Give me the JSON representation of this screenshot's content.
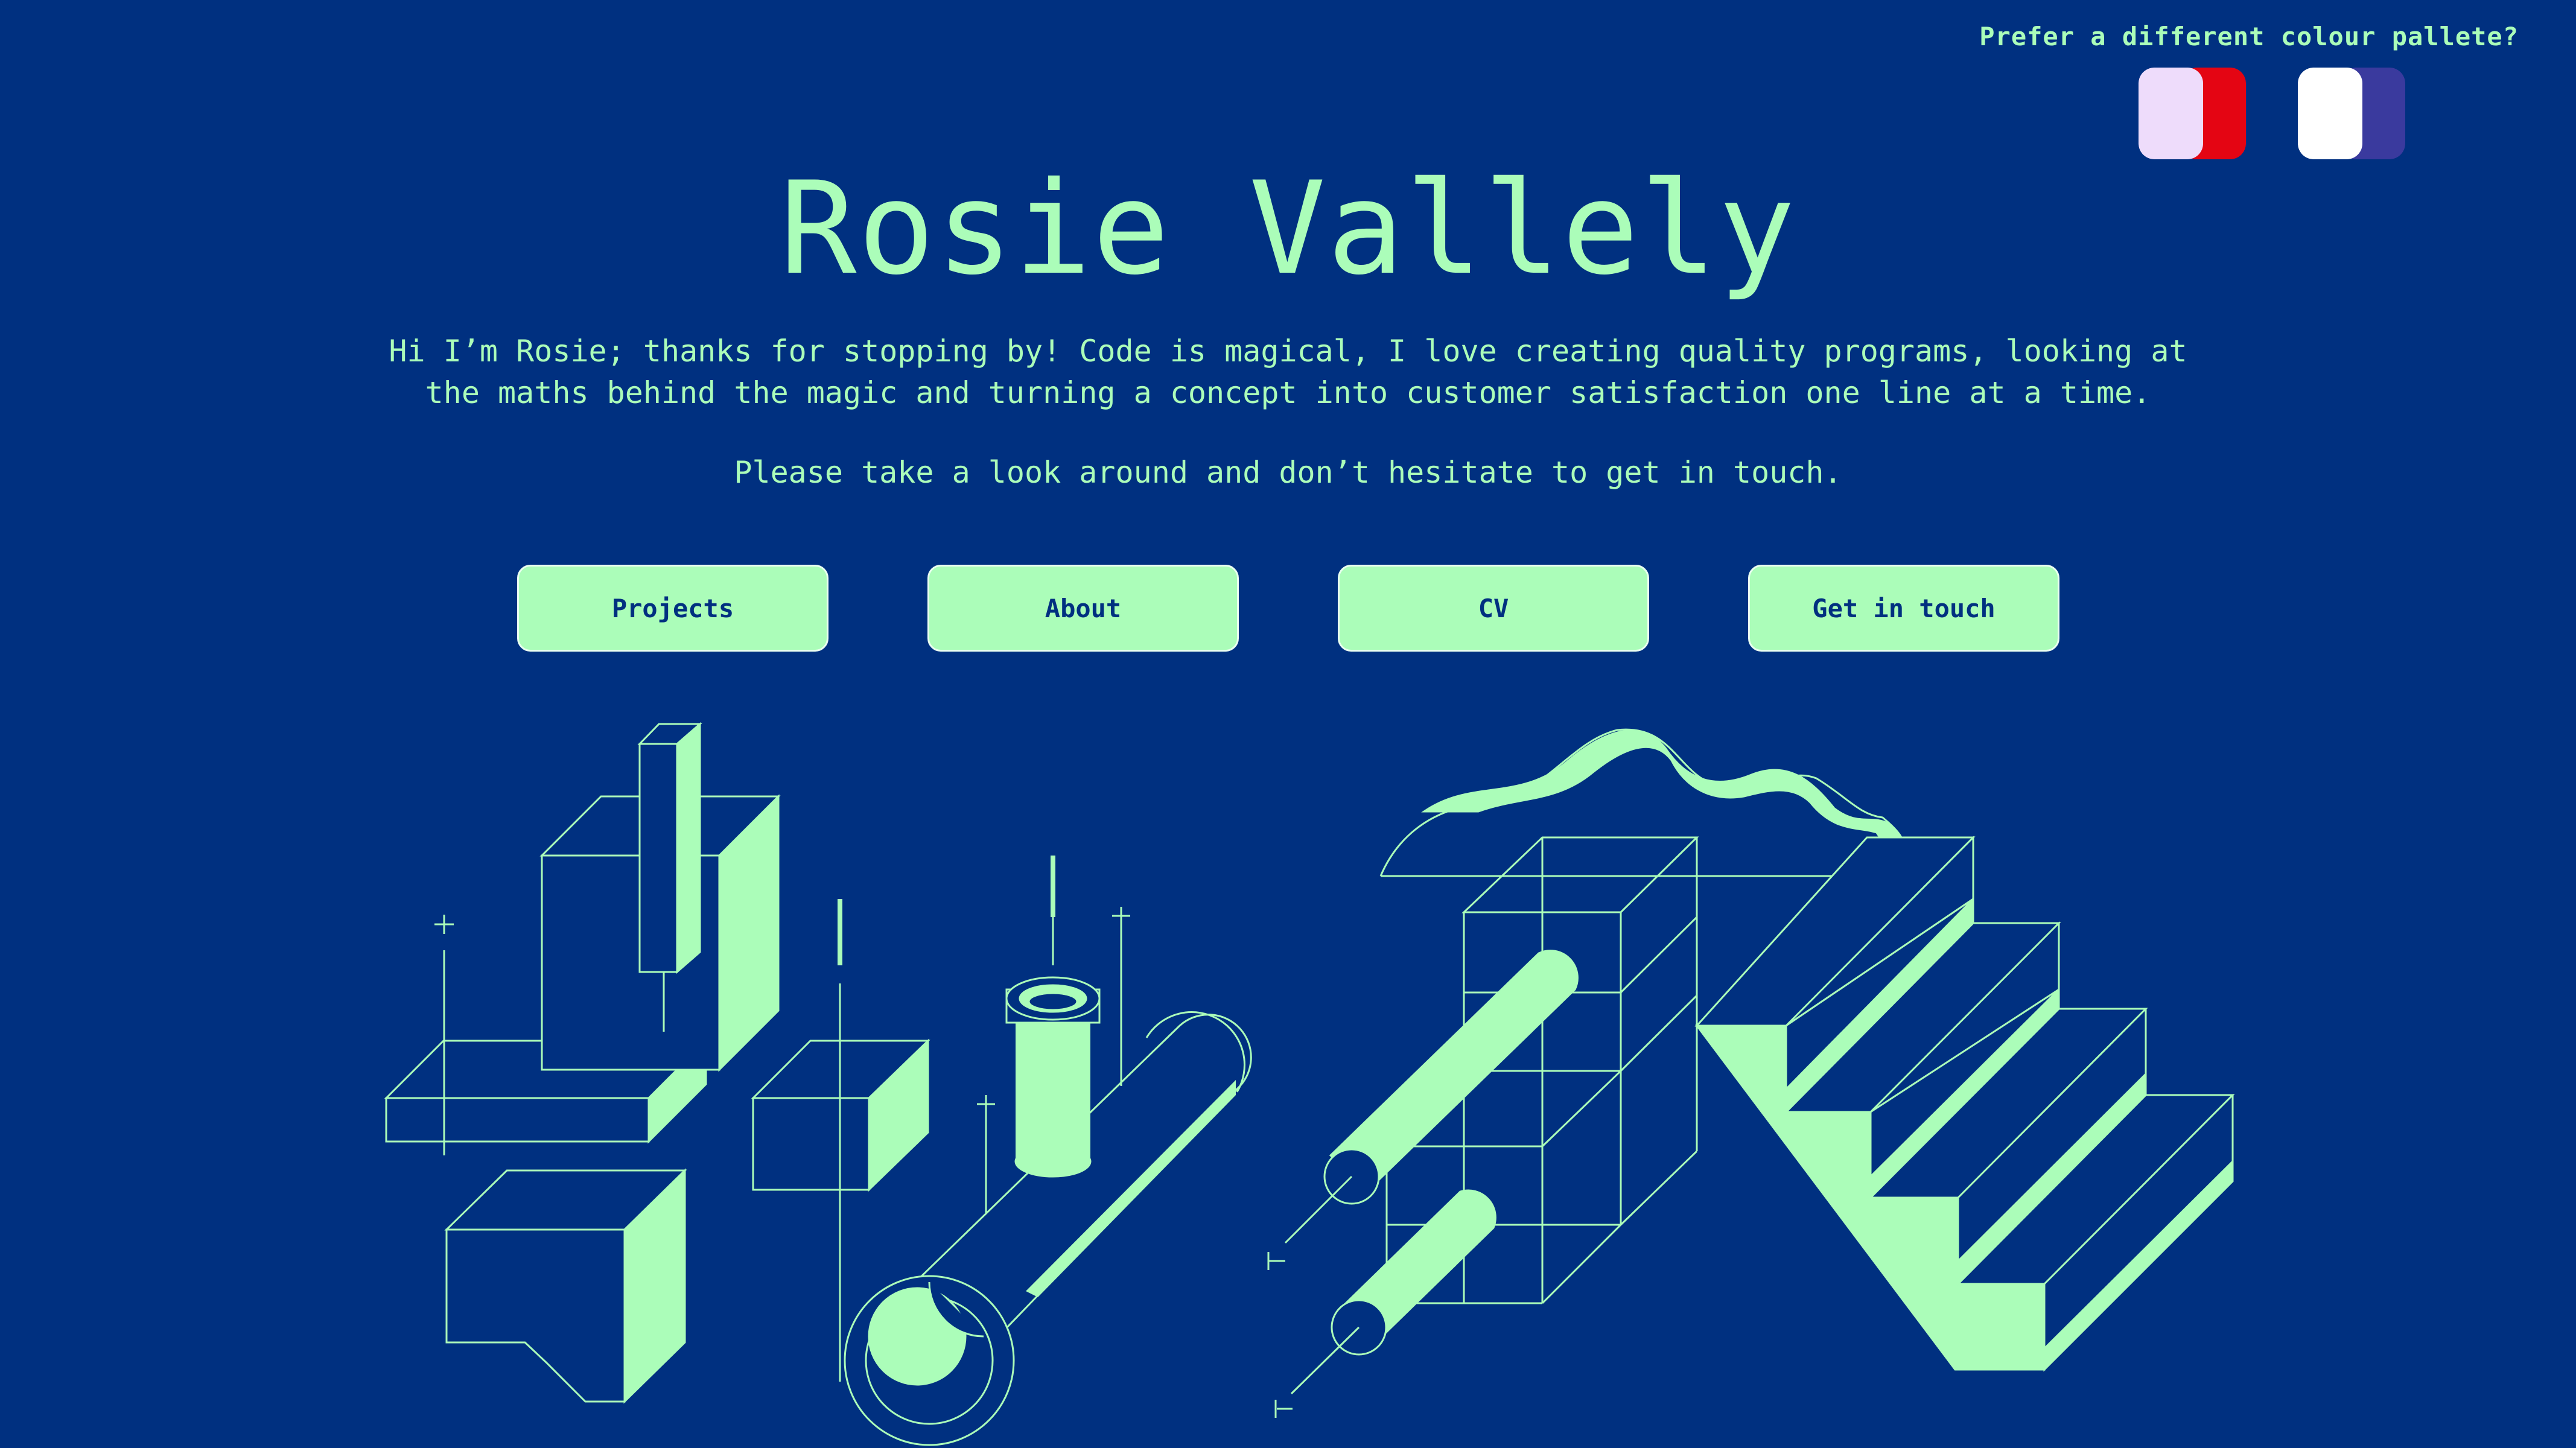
{
  "palette": {
    "prompt": "Prefer a different colour pallete?",
    "options": [
      {
        "name": "lilac-red",
        "left": "#eedcfb",
        "right": "#e40513"
      },
      {
        "name": "white-indigo",
        "left": "#ffffff",
        "right": "#3a3a9e"
      }
    ]
  },
  "hero": {
    "title": "Rosie Vallely",
    "intro": "Hi I’m Rosie; thanks for stopping by! Code is magical, I love creating quality programs, looking at the maths behind the magic and turning a concept into customer satisfaction one line at a time.",
    "cta": "Please take a look around and don’t hesitate to get in touch."
  },
  "nav": {
    "projects": "Projects",
    "about": "About",
    "cv": "CV",
    "contact": "Get in touch"
  },
  "colors": {
    "background": "#003080",
    "accent": "#abfdb9"
  }
}
